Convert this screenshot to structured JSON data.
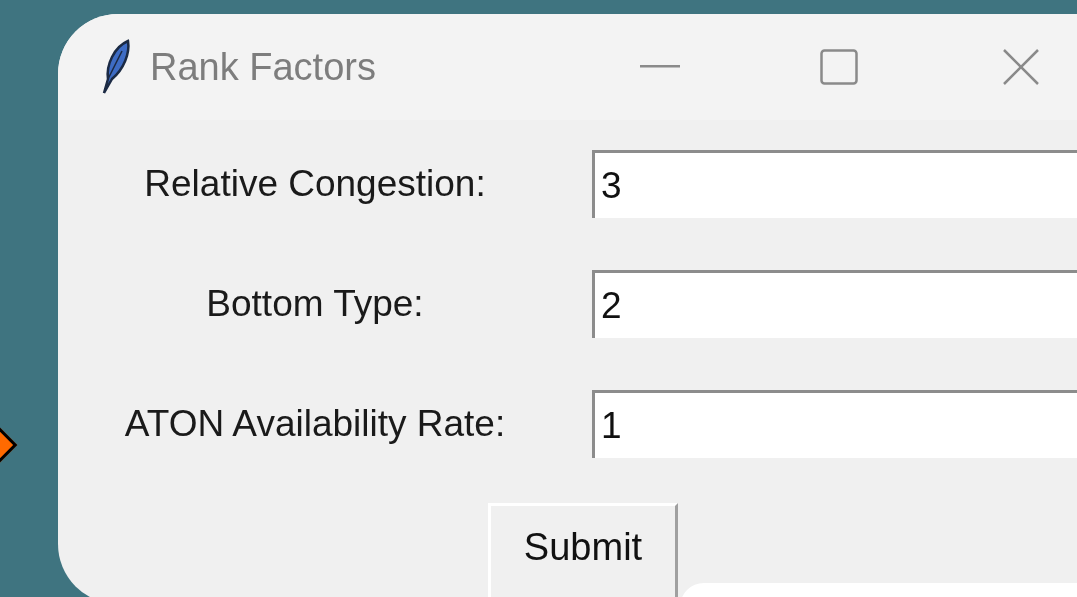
{
  "window": {
    "title": "Rank Factors"
  },
  "fields": [
    {
      "label": "Relative Congestion:",
      "value": "3"
    },
    {
      "label": "Bottom Type:",
      "value": "2"
    },
    {
      "label": "ATON Availability Rate:",
      "value": "1"
    }
  ],
  "submit_button": "Submit"
}
